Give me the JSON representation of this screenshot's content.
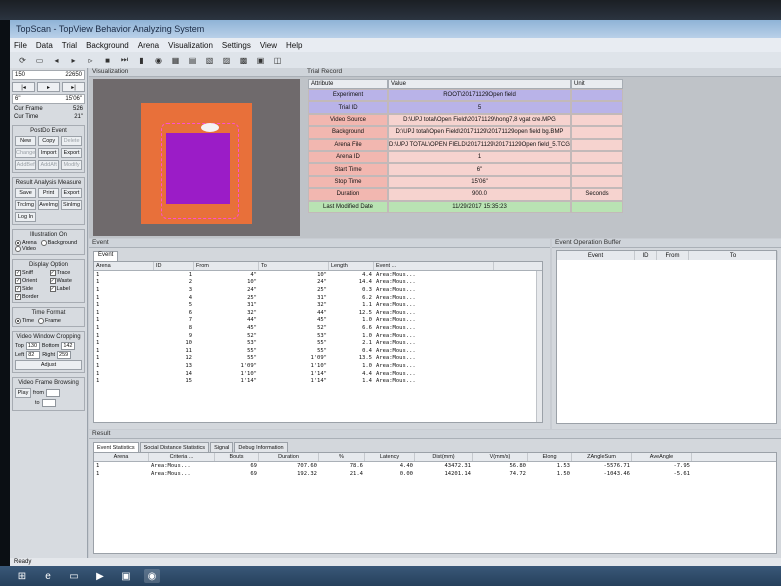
{
  "window": {
    "title": "TopScan - TopView Behavior Analyzing System"
  },
  "menu": [
    "File",
    "Data",
    "Trial",
    "Background",
    "Arena",
    "Visualization",
    "Settings",
    "View",
    "Help"
  ],
  "left": {
    "frame_start": "150",
    "frame_end": "22650",
    "time_start": "6\"",
    "time_end": "15'06\"",
    "cur_frame_label": "Cur Frame",
    "cur_frame_value": "526",
    "cur_time_label": "Cur Time",
    "cur_time_value": "21\"",
    "postdo_title": "PostDo Event",
    "postdo_buttons": [
      "New",
      "Copy",
      "Delete",
      "Change",
      "Import",
      "Export",
      "AddBef",
      "AddAft",
      "Modify"
    ],
    "result_title": "Result Analysis Measure",
    "result_buttons": [
      "Save",
      "Print",
      "Export",
      "TrcImg",
      "AveImg",
      "SinImg",
      "Log In"
    ],
    "illus_title": "Illustration On",
    "illus_opts": [
      "Arena",
      "Background",
      "Video"
    ],
    "display_title": "Display Option",
    "display_opts": [
      "Sniff",
      "Trace",
      "Orient",
      "Waste",
      "Side",
      "Label",
      "Border"
    ],
    "time_format_title": "Time Format",
    "time_format_opts": [
      "Time",
      "Frame"
    ],
    "zoom_title": "Video Window Cropping",
    "top_label": "Top",
    "top_val": "130",
    "bottom_label": "Bottom",
    "bottom_val": "142",
    "left_label": "Left",
    "left_val": "82",
    "right_label": "Right",
    "right_val": "259",
    "adjust": "Adjust",
    "browse_title": "Video Frame Browsing",
    "play": "Play",
    "from": "from",
    "to": "to"
  },
  "viz": {
    "title": "Visualization"
  },
  "trial": {
    "title": "Trial Record",
    "headers": [
      "Attribute",
      "Value",
      "Unit"
    ],
    "rows": [
      {
        "attr": "Experiment",
        "val": "ROOT\\20171129Open field",
        "unit": "",
        "style": "purple"
      },
      {
        "attr": "Trial ID",
        "val": "5",
        "unit": "",
        "style": "purple"
      },
      {
        "attr": "Video Source",
        "val": "D:\\UPJ total\\Open Field\\20171129\\hong7,8 vgat cre.MPG",
        "unit": "",
        "style": ""
      },
      {
        "attr": "Background",
        "val": "D:\\UPJ total\\Open Field\\20171129\\20171129open field bg.BMP",
        "unit": "",
        "style": ""
      },
      {
        "attr": "Arena File",
        "val": "D:\\UPJ TOTAL\\OPEN FIELD\\20171129\\20171129Open field_5.TCG",
        "unit": "",
        "style": ""
      },
      {
        "attr": "Arena ID",
        "val": "1",
        "unit": "",
        "style": ""
      },
      {
        "attr": "Start Time",
        "val": "6\"",
        "unit": "",
        "style": ""
      },
      {
        "attr": "Stop Time",
        "val": "15'06\"",
        "unit": "",
        "style": ""
      },
      {
        "attr": "Duration",
        "val": "900.0",
        "unit": "Seconds",
        "style": ""
      },
      {
        "attr": "Last Modified Date",
        "val": "11/29/2017 15:35:23",
        "unit": "",
        "style": "green"
      }
    ]
  },
  "event": {
    "title": "Event",
    "tab": "Event",
    "headers": [
      "Arena",
      "ID",
      "From",
      "To",
      "Length",
      "Event ..."
    ],
    "rows": [
      [
        "1",
        "1",
        "4\"",
        "10\"",
        "4.4",
        "Area:Mous..."
      ],
      [
        "1",
        "2",
        "10\"",
        "24\"",
        "14.4",
        "Area:Mous..."
      ],
      [
        "1",
        "3",
        "24\"",
        "25\"",
        "0.3",
        "Area:Mous..."
      ],
      [
        "1",
        "4",
        "25\"",
        "31\"",
        "6.2",
        "Area:Mous..."
      ],
      [
        "1",
        "5",
        "31\"",
        "32\"",
        "1.1",
        "Area:Mous..."
      ],
      [
        "1",
        "6",
        "32\"",
        "44\"",
        "12.5",
        "Area:Mous..."
      ],
      [
        "1",
        "7",
        "44\"",
        "45\"",
        "1.0",
        "Area:Mous..."
      ],
      [
        "1",
        "8",
        "45\"",
        "52\"",
        "6.6",
        "Area:Mous..."
      ],
      [
        "1",
        "9",
        "52\"",
        "53\"",
        "1.0",
        "Area:Mous..."
      ],
      [
        "1",
        "10",
        "53\"",
        "55\"",
        "2.1",
        "Area:Mous..."
      ],
      [
        "1",
        "11",
        "55\"",
        "55\"",
        "0.4",
        "Area:Mous..."
      ],
      [
        "1",
        "12",
        "55\"",
        "1'09\"",
        "13.5",
        "Area:Mous..."
      ],
      [
        "1",
        "13",
        "1'09\"",
        "1'10\"",
        "1.0",
        "Area:Mous..."
      ],
      [
        "1",
        "14",
        "1'10\"",
        "1'14\"",
        "4.4",
        "Area:Mous..."
      ],
      [
        "1",
        "15",
        "1'14\"",
        "1'14\"",
        "1.4",
        "Area:Mous..."
      ]
    ]
  },
  "buffer": {
    "title": "Event Operation Buffer",
    "headers": [
      "Event",
      "ID",
      "From",
      "To"
    ]
  },
  "result": {
    "title": "Result",
    "tabs": [
      "Event Statistics",
      "Social Distance Statistics",
      "Signal",
      "Debug Information"
    ],
    "headers": [
      "Arena",
      "Criteria ...",
      "Bouts",
      "Duration",
      "%",
      "Latency",
      "Dist(mm)",
      "V(mm/s)",
      "Elong",
      "ZAngleSum",
      "AveAngle"
    ],
    "rows": [
      [
        "1",
        "Area:Mous...",
        "69",
        "707.60",
        "78.6",
        "4.40",
        "43472.31",
        "56.80",
        "1.53",
        "-5576.71",
        "-7.95"
      ],
      [
        "1",
        "Area:Mous...",
        "69",
        "192.32",
        "21.4",
        "0.00",
        "14201.14",
        "74.72",
        "1.50",
        "-1043.46",
        "-5.61"
      ]
    ]
  },
  "status": "Ready"
}
